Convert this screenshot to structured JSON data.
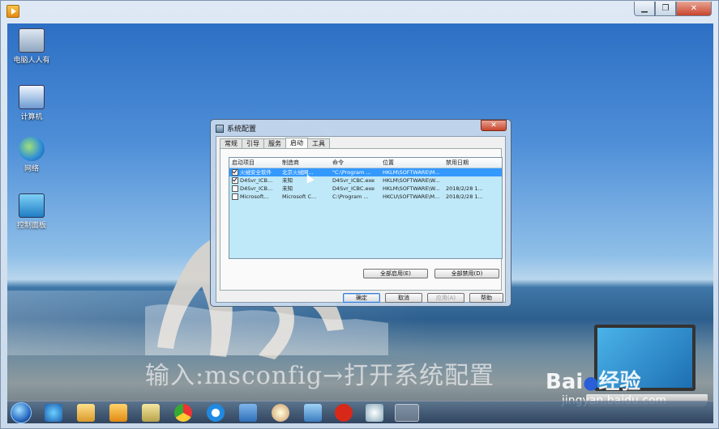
{
  "desktop_icons": [
    {
      "label": "电脑人人有"
    },
    {
      "label": "计算机"
    },
    {
      "label": "网络"
    },
    {
      "label": "控制面板"
    }
  ],
  "dialog": {
    "title": "系统配置",
    "close": "✕",
    "tabs": [
      "常规",
      "引导",
      "服务",
      "启动",
      "工具"
    ],
    "active_tab": "启动",
    "columns": [
      "启动项目",
      "制造商",
      "命令",
      "位置",
      "禁用日期"
    ],
    "rows": [
      {
        "checked": true,
        "item": "火绒安全软件",
        "maker": "北京火绒网...",
        "cmd": "\"C:\\Program ...",
        "loc": "HKLM\\SOFTWARE\\M...",
        "date": ""
      },
      {
        "checked": true,
        "item": "D4Svr_ICB...",
        "maker": "未知",
        "cmd": "D4Svr_ICBC.exe",
        "loc": "HKLM\\SOFTWARE\\W...",
        "date": ""
      },
      {
        "checked": false,
        "item": "D4Svr_ICB...",
        "maker": "未知",
        "cmd": "D4Svr_ICBC.exe",
        "loc": "HKLM\\SOFTWARE\\W...",
        "date": "2018/2/28 1..."
      },
      {
        "checked": false,
        "item": "Microsoft...",
        "maker": "Microsoft C...",
        "cmd": "C:\\Program ...",
        "loc": "HKCU\\SOFTWARE\\M...",
        "date": "2018/2/28 1..."
      }
    ],
    "enable_all": "全部启用(E)",
    "disable_all": "全部禁用(D)",
    "ok": "确定",
    "cancel": "取消",
    "apply": "应用(A)",
    "help": "帮助"
  },
  "caption": "输入:msconfig→打开系统配置",
  "watermark": {
    "brand_left": "Bai",
    "brand_right": "经验",
    "url": "jingyan.baidu.com"
  },
  "window_controls": {
    "minimize": "▁",
    "restore": "❐",
    "close": "✕"
  }
}
